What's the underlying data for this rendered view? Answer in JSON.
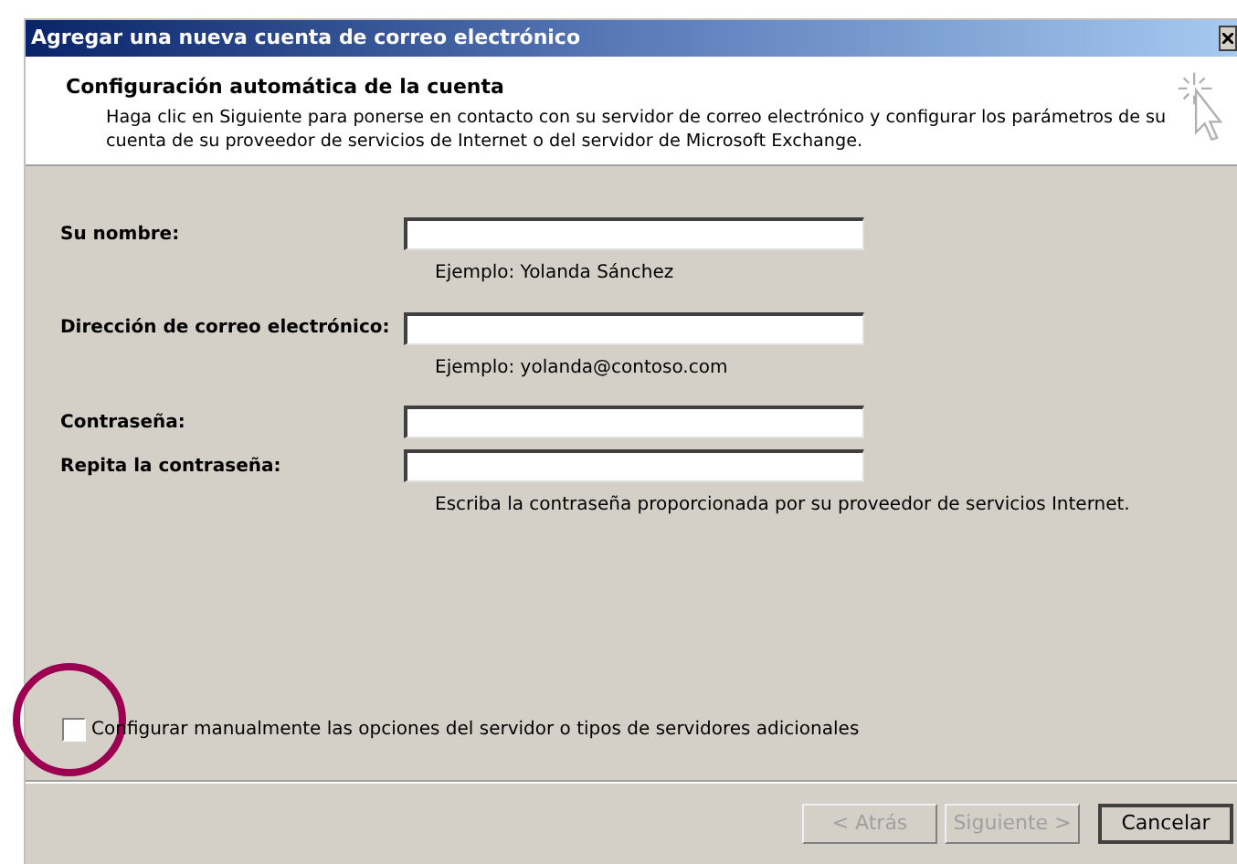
{
  "window": {
    "title": "Agregar una nueva cuenta de correo electrónico"
  },
  "header": {
    "title": "Configuración automática de la cuenta",
    "description": "Haga clic en Siguiente para ponerse en contacto con su servidor de correo electrónico y configurar los parámetros de su cuenta de su proveedor de servicios de Internet o del servidor de Microsoft Exchange."
  },
  "fields": [
    {
      "label": "Su nombre:",
      "hint": "Ejemplo: Yolanda Sánchez"
    },
    {
      "label": "Dirección de correo electrónico:",
      "hint": "Ejemplo: yolanda@contoso.com"
    },
    {
      "label": "Contraseña:"
    },
    {
      "label": "Repita la contraseña:",
      "hint": "Escriba la contraseña proporcionada por su proveedor de servicios Internet."
    }
  ],
  "manual_setup": {
    "label": "Configurar manualmente las opciones del servidor o tipos de servidores adicionales",
    "checked": false
  },
  "buttons": [
    {
      "label": "< Atrás",
      "disabled": true
    },
    {
      "label": "Siguiente >",
      "disabled": true
    },
    {
      "label": "Cancelar",
      "disabled": false
    }
  ]
}
